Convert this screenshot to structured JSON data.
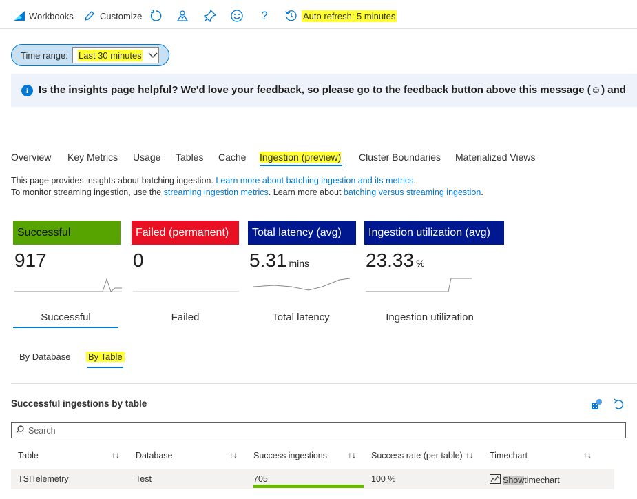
{
  "toolbar": {
    "workbooks_label": "Workbooks",
    "customize_label": "Customize",
    "auto_refresh_label": "Auto refresh: 5 minutes"
  },
  "time_range": {
    "label": "Time range:",
    "value": "Last 30 minutes"
  },
  "banner": {
    "text": "Is the insights page helpful? We'd love your feedback, so please go to the feedback button above this message (☺) and"
  },
  "tabs": [
    {
      "label": "Overview"
    },
    {
      "label": "Key Metrics"
    },
    {
      "label": "Usage"
    },
    {
      "label": "Tables"
    },
    {
      "label": "Cache"
    },
    {
      "label": "Ingestion (preview)"
    },
    {
      "label": "Cluster Boundaries"
    },
    {
      "label": "Materialized Views"
    }
  ],
  "description": {
    "line1_text": "This page provides insights about batching ingestion. ",
    "line1_link": "Learn more about batching ingestion and its metrics",
    "line1_end": ".",
    "line2_text": "To monitor streaming ingestion, use the ",
    "line2_link1": "streaming ingestion metrics",
    "line2_mid": ". Learn more about ",
    "line2_link2": "batching versus streaming ingestion",
    "line2_end": "."
  },
  "tiles": [
    {
      "title": "Successful",
      "value": "917",
      "unit": "",
      "tab": "Successful",
      "color": "#57a300"
    },
    {
      "title": "Failed (permanent)",
      "value": "0",
      "unit": "",
      "tab": "Failed",
      "color": "#e81123"
    },
    {
      "title": "Total latency (avg)",
      "value": "5.31",
      "unit": "mins",
      "tab": "Total latency",
      "color": "#00188f"
    },
    {
      "title": "Ingestion utilization (avg)",
      "value": "23.33",
      "unit": "%",
      "tab": "Ingestion utilization",
      "color": "#00188f"
    }
  ],
  "subtabs": [
    {
      "label": "By Database"
    },
    {
      "label": "By Table"
    }
  ],
  "section": {
    "title": "Successful ingestions by table"
  },
  "search": {
    "placeholder": "Search"
  },
  "table": {
    "columns": [
      "Table",
      "Database",
      "Success ingestions",
      "Success rate (per table)",
      "Timechart"
    ],
    "rows": [
      {
        "table": "TSITelemetry",
        "database": "Test",
        "success_ingestions": "705",
        "success_rate": "100 %",
        "timechart_show": "Show",
        "timechart_rest": " timechart"
      }
    ]
  },
  "icons": {
    "workbooks": "workbooks-icon",
    "customize": "pencil-icon",
    "refresh": "refresh-icon",
    "feedback_people": "community-icon",
    "pin": "pin-icon",
    "smiley": "smiley-icon",
    "help": "help-icon",
    "auto_refresh": "history-icon"
  },
  "colors": {
    "accent": "#0078d4",
    "highlight": "#ffff33",
    "success": "#57a300",
    "failed": "#e81123",
    "navy": "#00188f"
  }
}
